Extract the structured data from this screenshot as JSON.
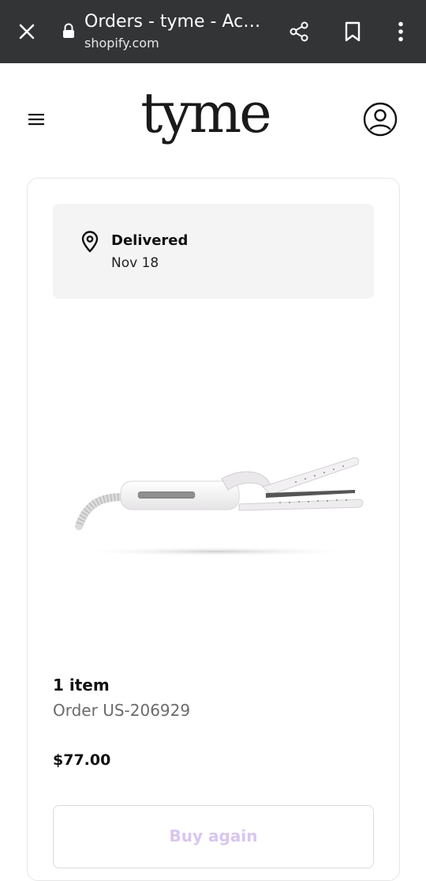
{
  "browser": {
    "title": "Orders - tyme - Acc…",
    "url": "shopify.com",
    "icons": {
      "close": "close-icon",
      "lock": "lock-icon",
      "share": "share-icon",
      "bookmark": "bookmark-icon",
      "menu": "more-vert-icon"
    }
  },
  "header": {
    "logo": "tyme",
    "icons": {
      "menu": "hamburger-icon",
      "account": "account-icon"
    }
  },
  "order": {
    "status": "Delivered",
    "date": "Nov 18",
    "item_count": "1 item",
    "order_number": "Order US-206929",
    "price": "$77.00",
    "buy_again_label": "Buy again"
  },
  "colors": {
    "browser_bar": "#333436",
    "buy_again_text": "#d9c6ee",
    "status_box": "#f4f4f4"
  }
}
